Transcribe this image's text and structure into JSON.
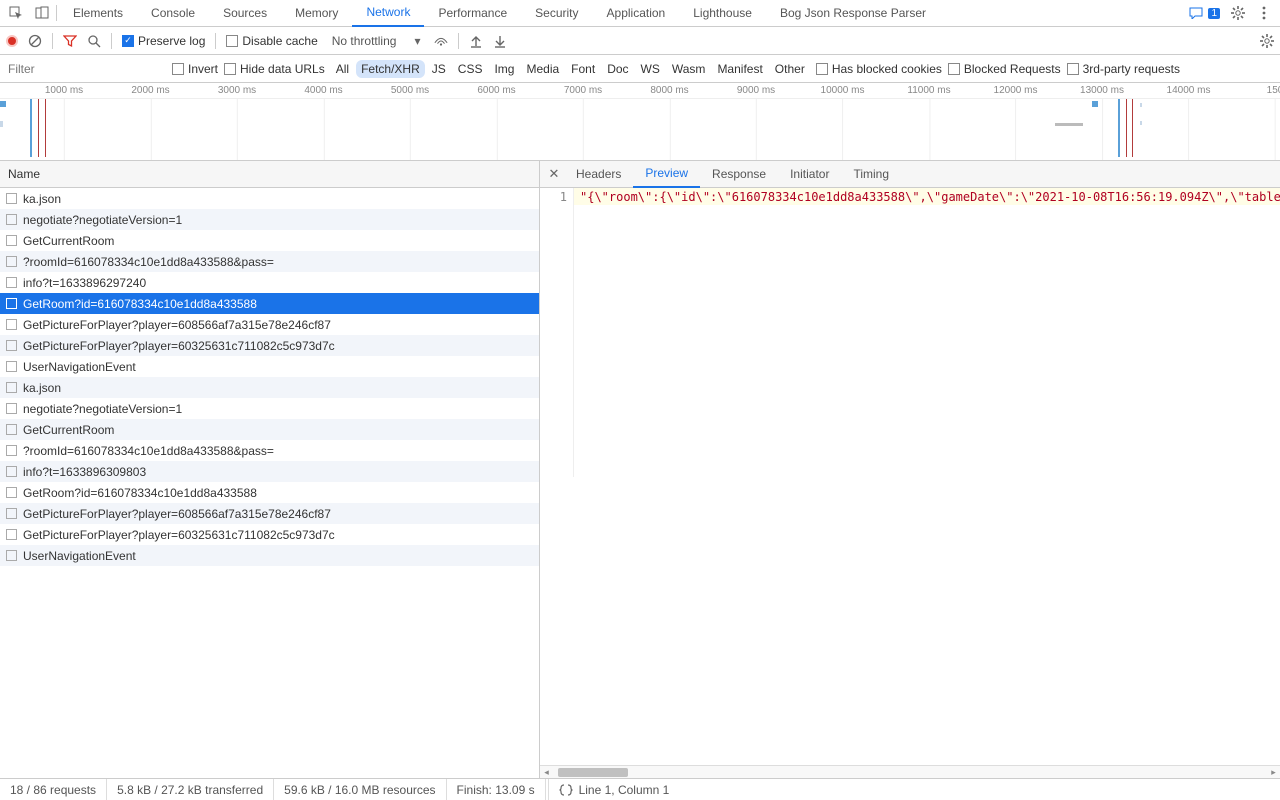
{
  "topTabs": [
    "Elements",
    "Console",
    "Sources",
    "Memory",
    "Network",
    "Performance",
    "Security",
    "Application",
    "Lighthouse",
    "Bog Json Response Parser"
  ],
  "activeTopTab": 4,
  "messageBadge": "1",
  "toolbar": {
    "preserveLog": "Preserve log",
    "disableCache": "Disable cache",
    "throttling": "No throttling"
  },
  "filter": {
    "placeholder": "Filter",
    "invert": "Invert",
    "hideDataUrls": "Hide data URLs",
    "types": [
      "All",
      "Fetch/XHR",
      "JS",
      "CSS",
      "Img",
      "Media",
      "Font",
      "Doc",
      "WS",
      "Wasm",
      "Manifest",
      "Other"
    ],
    "activeType": 1,
    "hasBlockedCookies": "Has blocked cookies",
    "blockedRequests": "Blocked Requests",
    "thirdParty": "3rd-party requests"
  },
  "timelineTicks": [
    "1000 ms",
    "2000 ms",
    "3000 ms",
    "4000 ms",
    "5000 ms",
    "6000 ms",
    "7000 ms",
    "8000 ms",
    "9000 ms",
    "10000 ms",
    "11000 ms",
    "12000 ms",
    "13000 ms",
    "14000 ms",
    "150"
  ],
  "nameHeader": "Name",
  "requests": [
    "ka.json",
    "negotiate?negotiateVersion=1",
    "GetCurrentRoom",
    "?roomId=616078334c10e1dd8a433588&pass=",
    "info?t=1633896297240",
    "GetRoom?id=616078334c10e1dd8a433588",
    "GetPictureForPlayer?player=608566af7a315e78e246cf87",
    "GetPictureForPlayer?player=60325631c711082c5c973d7c",
    "UserNavigationEvent",
    "ka.json",
    "negotiate?negotiateVersion=1",
    "GetCurrentRoom",
    "?roomId=616078334c10e1dd8a433588&pass=",
    "info?t=1633896309803",
    "GetRoom?id=616078334c10e1dd8a433588",
    "GetPictureForPlayer?player=608566af7a315e78e246cf87",
    "GetPictureForPlayer?player=60325631c711082c5c973d7c",
    "UserNavigationEvent"
  ],
  "selectedRequest": 5,
  "detailTabs": [
    "Headers",
    "Preview",
    "Response",
    "Initiator",
    "Timing"
  ],
  "activeDetailTab": 1,
  "preview": {
    "lineNo": "1",
    "content": "\"{\\\"room\\\":{\\\"id\\\":\\\"616078334c10e1dd8a433588\\\",\\\"gameDate\\\":\\\"2021-10-08T16:56:19.094Z\\\",\\\"table\\\":[{\\\"s"
  },
  "status": {
    "requests": "18 / 86 requests",
    "transferred": "5.8 kB / 27.2 kB transferred",
    "resources": "59.6 kB / 16.0 MB resources",
    "finish": "Finish: 13.09 s",
    "cursor": "Line 1, Column 1"
  }
}
